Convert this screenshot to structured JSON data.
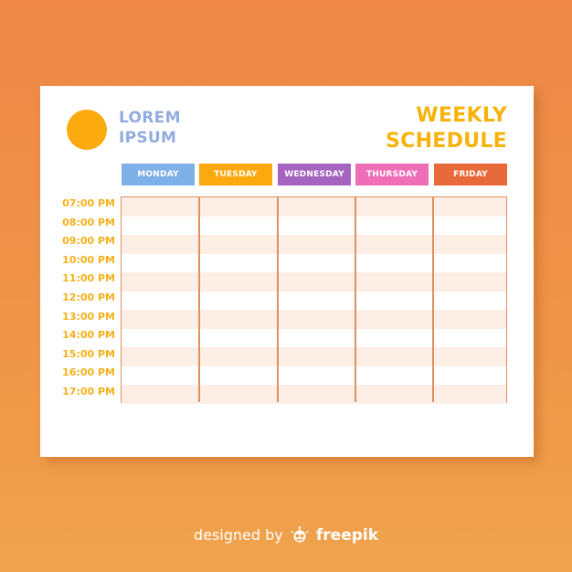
{
  "brand": {
    "line1": "LOREM",
    "line2": "IPSUM",
    "logo_color": "#fbab0e",
    "text_color": "#93acdf"
  },
  "title": {
    "line1": "WEEKLY",
    "line2": "SCHEDULE",
    "color": "#f7b30c"
  },
  "days": [
    {
      "label": "MONDAY",
      "color": "#7eb1e8"
    },
    {
      "label": "TUESDAY",
      "color": "#fba90f"
    },
    {
      "label": "WEDNESDAY",
      "color": "#a464bf"
    },
    {
      "label": "THURSDAY",
      "color": "#ee6fb5"
    },
    {
      "label": "FRIDAY",
      "color": "#e8693a"
    }
  ],
  "times": [
    "07:00 PM",
    "08:00 PM",
    "09:00 PM",
    "10:00 PM",
    "11:00 PM",
    "12:00 PM",
    "13:00 PM",
    "14:00 PM",
    "15:00 PM",
    "16:00 PM",
    "17:00 PM"
  ],
  "grid": {
    "border_color": "#e09060",
    "shade_color": "#fdefe6"
  },
  "footer": {
    "prefix": "designed by",
    "brand": "freepik"
  }
}
